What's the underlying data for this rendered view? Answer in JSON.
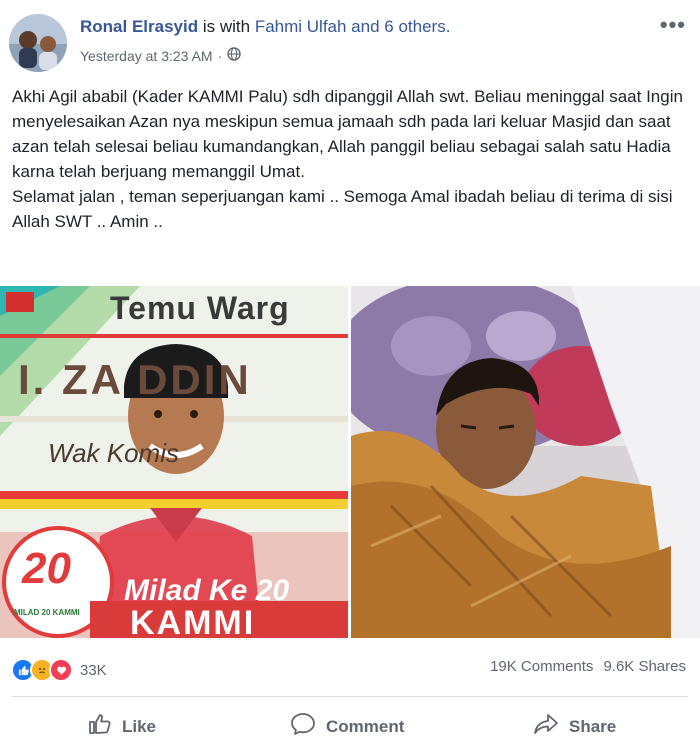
{
  "post": {
    "author": "Ronal Elrasyid",
    "with_text": "is with",
    "tagged": "Fahmi Ulfah and 6 others.",
    "timestamp": "Yesterday at 3:23 AM",
    "privacy_separator": "·",
    "privacy_icon": "globe-icon",
    "paragraphs": [
      "Akhi Agil ababil (Kader KAMMI Palu) sdh dipanggil Allah swt. Beliau meninggal saat Ingin menyelesaikan Azan nya meskipun semua jamaah sdh pada lari keluar Masjid dan saat azan telah selesai beliau kumandangkan, Allah panggil beliau sebagai salah satu Hadia karna telah berjuang memanggil Umat.",
      "Selamat jalan , teman seperjuangan kami .. Semoga Amal ibadah beliau di terima di sisi Allah SWT .. Amin .."
    ]
  },
  "photo_left": {
    "banner_top": "Temu Warg",
    "banner_name": "I. ZA   DDIN",
    "banner_sub": "Wak       Komis",
    "milad": "Milad Ke 20",
    "kammi": "KAMMI",
    "logo_text": "20",
    "logo_caption": "MILAD 20 KAMMI"
  },
  "stats": {
    "reaction_count": "33K",
    "comments": "19K Comments",
    "shares": "9.6K Shares"
  },
  "actions": {
    "like": "Like",
    "comment": "Comment",
    "share": "Share"
  },
  "colors": {
    "link": "#365899",
    "text": "#1d2129",
    "secondary": "#606770",
    "like_blue": "#1877f2",
    "sad_yellow": "#f7b125",
    "love_red": "#f33e58"
  }
}
